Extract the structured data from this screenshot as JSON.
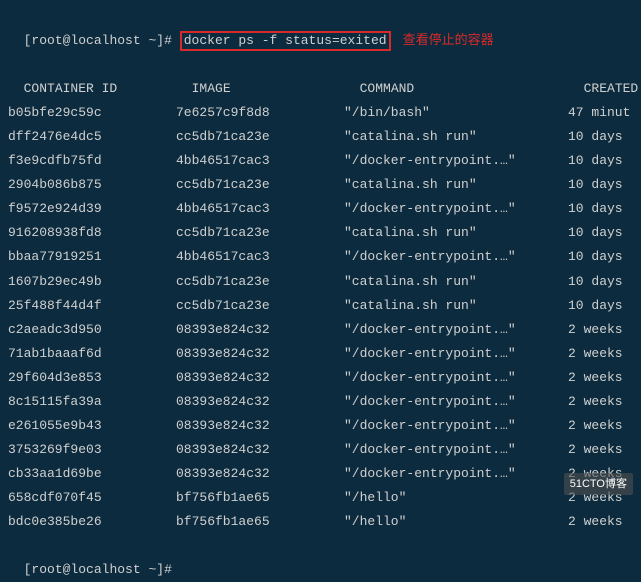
{
  "prompt": {
    "open_bracket": "[",
    "user": "root",
    "at": "@",
    "host": "localhost",
    "space": " ",
    "path": "~",
    "close_bracket": "]",
    "hash": "#"
  },
  "command": "docker ps -f status=exited",
  "annotation": "查看停止的容器",
  "headers": {
    "container_id": "CONTAINER ID",
    "image": "IMAGE",
    "command": "COMMAND",
    "created": "CREATED"
  },
  "rows": [
    {
      "id": "b05bfe29c59c",
      "image": "7e6257c9f8d8",
      "cmd": "\"/bin/bash\"",
      "created": "47 minut"
    },
    {
      "id": "dff2476e4dc5",
      "image": "cc5db71ca23e",
      "cmd": "\"catalina.sh run\"",
      "created": "10 days"
    },
    {
      "id": "f3e9cdfb75fd",
      "image": "4bb46517cac3",
      "cmd": "\"/docker-entrypoint.…\"",
      "created": "10 days"
    },
    {
      "id": "2904b086b875",
      "image": "cc5db71ca23e",
      "cmd": "\"catalina.sh run\"",
      "created": "10 days"
    },
    {
      "id": "f9572e924d39",
      "image": "4bb46517cac3",
      "cmd": "\"/docker-entrypoint.…\"",
      "created": "10 days"
    },
    {
      "id": "916208938fd8",
      "image": "cc5db71ca23e",
      "cmd": "\"catalina.sh run\"",
      "created": "10 days"
    },
    {
      "id": "bbaa77919251",
      "image": "4bb46517cac3",
      "cmd": "\"/docker-entrypoint.…\"",
      "created": "10 days"
    },
    {
      "id": "1607b29ec49b",
      "image": "cc5db71ca23e",
      "cmd": "\"catalina.sh run\"",
      "created": "10 days"
    },
    {
      "id": "25f488f44d4f",
      "image": "cc5db71ca23e",
      "cmd": "\"catalina.sh run\"",
      "created": "10 days"
    },
    {
      "id": "c2aeadc3d950",
      "image": "08393e824c32",
      "cmd": "\"/docker-entrypoint.…\"",
      "created": "2 weeks"
    },
    {
      "id": "71ab1baaaf6d",
      "image": "08393e824c32",
      "cmd": "\"/docker-entrypoint.…\"",
      "created": "2 weeks"
    },
    {
      "id": "29f604d3e853",
      "image": "08393e824c32",
      "cmd": "\"/docker-entrypoint.…\"",
      "created": "2 weeks"
    },
    {
      "id": "8c15115fa39a",
      "image": "08393e824c32",
      "cmd": "\"/docker-entrypoint.…\"",
      "created": "2 weeks"
    },
    {
      "id": "e261055e9b43",
      "image": "08393e824c32",
      "cmd": "\"/docker-entrypoint.…\"",
      "created": "2 weeks"
    },
    {
      "id": "3753269f9e03",
      "image": "08393e824c32",
      "cmd": "\"/docker-entrypoint.…\"",
      "created": "2 weeks"
    },
    {
      "id": "cb33aa1d69be",
      "image": "08393e824c32",
      "cmd": "\"/docker-entrypoint.…\"",
      "created": "2 weeks"
    },
    {
      "id": "658cdf070f45",
      "image": "bf756fb1ae65",
      "cmd": "\"/hello\"",
      "created": "2 weeks"
    },
    {
      "id": "bdc0e385be26",
      "image": "bf756fb1ae65",
      "cmd": "\"/hello\"",
      "created": "2 weeks"
    }
  ],
  "watermark": "51CTO博客"
}
